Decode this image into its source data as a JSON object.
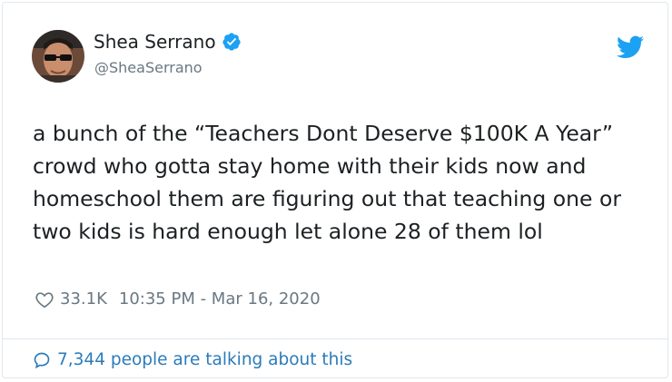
{
  "tweet": {
    "author": {
      "display_name": "Shea Serrano",
      "handle": "@SheaSerrano",
      "verified": true
    },
    "text": "a bunch of the “Teachers Dont Deserve $100K A Year” crowd who gotta stay home with their kids now and homeschool them are figuring out that teaching one or two kids is hard enough let alone 28 of them lol",
    "likes": "33.1K",
    "timestamp": "10:35 PM - Mar 16, 2020",
    "talking": "7,344 people are talking about this"
  },
  "icons": {
    "verified": "verified-badge-icon",
    "brand": "twitter-bird-icon",
    "like": "heart-icon",
    "conversation": "speech-bubble-icon"
  },
  "colors": {
    "twitter_blue": "#1da1f2",
    "link_blue": "#2b7bb9",
    "text": "#1c2022",
    "secondary": "#697882",
    "border": "#e1e8ed"
  }
}
